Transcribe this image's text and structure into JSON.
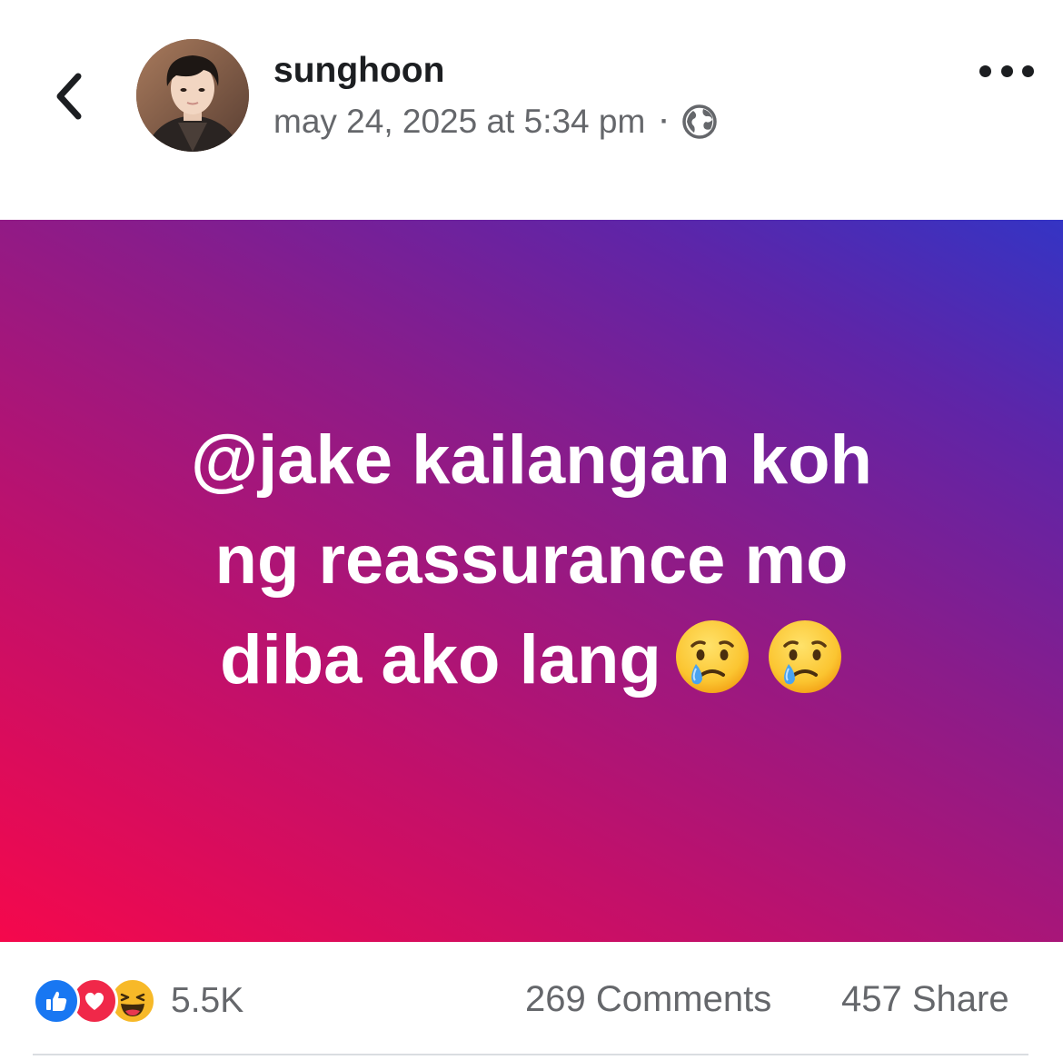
{
  "header": {
    "username": "sunghoon",
    "timestamp": "may 24, 2025 at 5:34 pm",
    "separator": "·",
    "privacy_icon": "globe-icon",
    "back_icon": "chevron-left-icon",
    "more_icon": "more-horizontal-icon"
  },
  "post": {
    "line1": "@jake kailangan koh",
    "line2": "ng reassurance mo",
    "line3": "diba ako lang",
    "emojis": [
      "crying-face-icon",
      "crying-face-icon"
    ],
    "gradient_colors": [
      "#f5084c",
      "#c2106a",
      "#8a1c8a",
      "#5e25a8",
      "#3434c4"
    ]
  },
  "footer": {
    "reaction_icons": [
      "like-icon",
      "love-icon",
      "haha-icon"
    ],
    "reaction_count": "5.5K",
    "comments_label": "269 Comments",
    "share_label": "457 Share"
  },
  "colors": {
    "like_blue": "#1877f2",
    "love_red": "#f02849",
    "haha_yellow": "#f7b928",
    "secondary_text": "#65676b"
  }
}
